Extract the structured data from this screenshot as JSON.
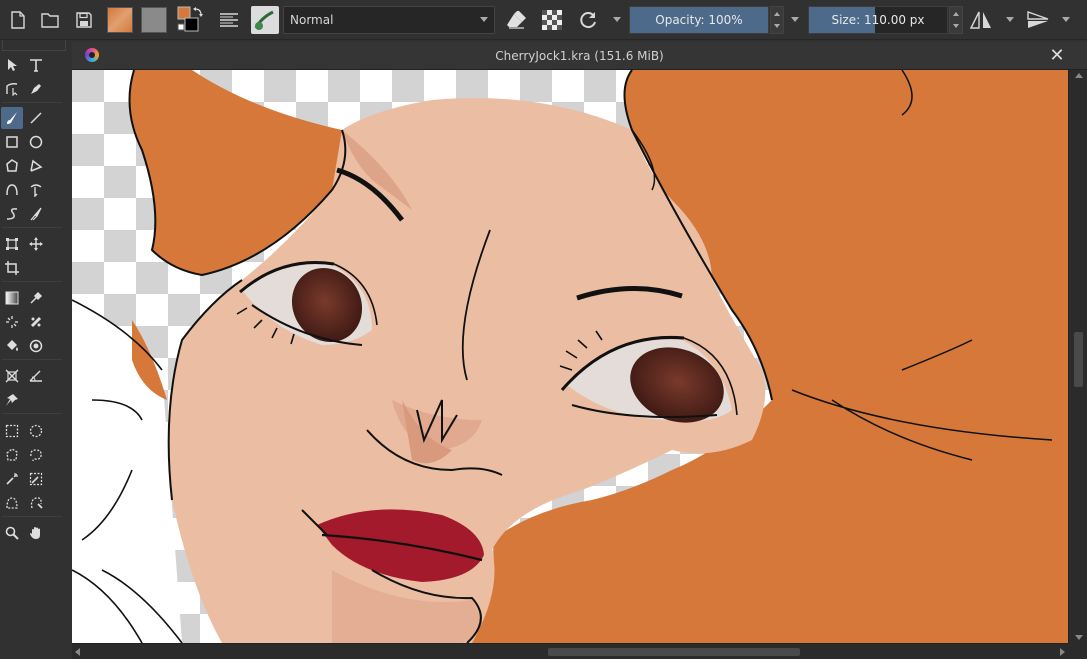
{
  "toolbar": {
    "blend_mode": "Normal",
    "opacity_label": "Opacity: 100%",
    "opacity_value": 100,
    "size_label": "Size: 110.00 px",
    "size_value": 110.0,
    "foreground_color": "#d5783a",
    "background_color": "#000000",
    "accent_color": "#4d6a8a",
    "icons": [
      "new-document-icon",
      "open-document-icon",
      "save-icon",
      "gradient-swatch-icon",
      "pattern-swatch-icon",
      "color-swap-icon",
      "brush-settings-icon",
      "brush-preset-icon",
      "eraser-icon",
      "alpha-lock-icon",
      "reload-preset-icon",
      "mirror-horizontal-icon",
      "mirror-vertical-icon"
    ]
  },
  "toolbox": {
    "active_tool": "freehand-brush-tool",
    "tools": [
      "select-shapes-tool",
      "text-tool",
      "edit-shapes-tool",
      "calligraphy-tool",
      "freehand-brush-tool",
      "line-tool",
      "rectangle-tool",
      "ellipse-tool",
      "polygon-tool",
      "polyline-tool",
      "bezier-curve-tool",
      "freehand-path-tool",
      "dynamic-brush-tool",
      "multibrush-tool",
      "transform-tool",
      "move-tool",
      "crop-tool",
      "gradient-tool",
      "color-picker-tool",
      "colorize-mask-tool",
      "smart-patch-tool",
      "fill-tool",
      "enclose-fill-tool",
      "assistant-tool",
      "measure-tool",
      "reference-images-tool",
      "rectangular-selection-tool",
      "elliptical-selection-tool",
      "polygonal-selection-tool",
      "freehand-selection-tool",
      "contiguous-selection-tool",
      "similar-color-selection-tool",
      "bezier-selection-tool",
      "magnetic-selection-tool",
      "zoom-tool",
      "pan-tool"
    ]
  },
  "document": {
    "title": "CherryJock1.kra (151.6 MiB)",
    "close_label": "✕"
  },
  "artwork": {
    "skin": "#ebbea3",
    "skin_shadow": "#dea48a",
    "hair": "#d5783a",
    "lips": "#a31a2c",
    "iris": "#5a2a20",
    "eye_white": "#e4dcd8",
    "line": "#111111"
  }
}
